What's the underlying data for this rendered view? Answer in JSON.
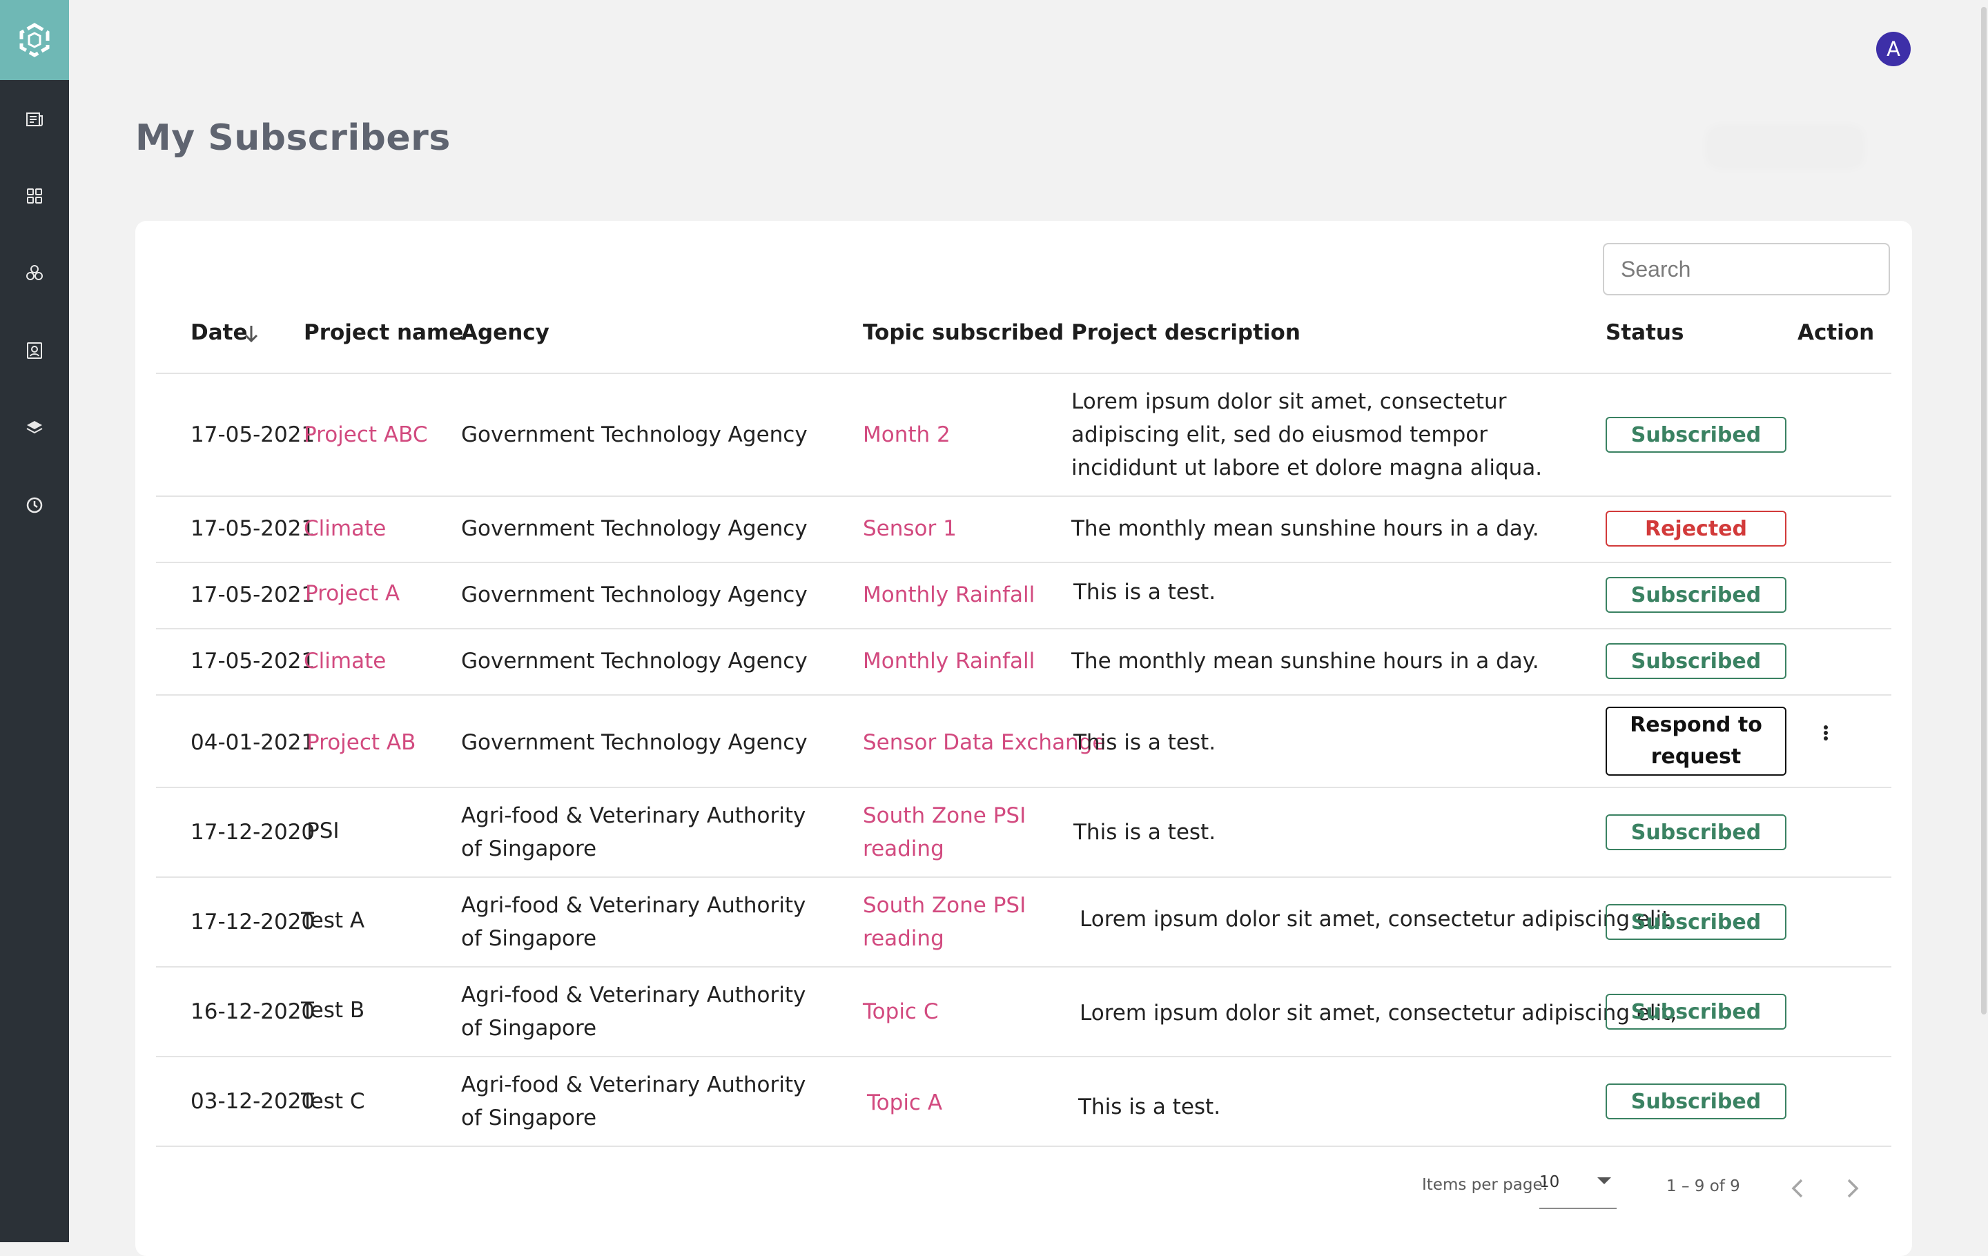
{
  "app": {
    "avatar_initial": "A",
    "accent_color": "#6fb8b5",
    "sidebar_color": "#2b3137"
  },
  "sidebar": {
    "items": [
      {
        "icon": "newspaper-icon"
      },
      {
        "icon": "grid-icon"
      },
      {
        "icon": "circles-cluster-icon"
      },
      {
        "icon": "contact-card-icon"
      },
      {
        "icon": "layers-icon"
      },
      {
        "icon": "clock-icon"
      }
    ]
  },
  "page": {
    "title": "My Subscribers"
  },
  "search": {
    "placeholder": "Search",
    "value": ""
  },
  "table": {
    "headers": {
      "date": "Date",
      "project_name": "Project name",
      "agency": "Agency",
      "topic": "Topic subscribed",
      "description": "Project description",
      "status": "Status",
      "action": "Action"
    },
    "sort": {
      "column": "date",
      "direction": "descending"
    },
    "rows": [
      {
        "date": "17-05-2021",
        "project": "Project ABC",
        "project_link": true,
        "agency": "Government Technology Agency",
        "topic": "Month 2",
        "description": "Lorem ipsum dolor sit amet, consectetur adipiscing elit, sed do eiusmod tempor incididunt ut labore et dolore magna aliqua.",
        "status": "Subscribed",
        "status_type": "subscribed"
      },
      {
        "date": "17-05-2021",
        "project": "Climate",
        "project_link": true,
        "agency": "Government Technology Agency",
        "topic": "Sensor 1",
        "description": "The monthly mean sunshine hours in a day.",
        "status": "Rejected",
        "status_type": "rejected"
      },
      {
        "date": "17-05-2021",
        "project": "Project A",
        "project_link": true,
        "agency": "Government Technology Agency",
        "topic": "Monthly Rainfall",
        "description": "This is a test.",
        "status": "Subscribed",
        "status_type": "subscribed"
      },
      {
        "date": "17-05-2021",
        "project": "Climate",
        "project_link": true,
        "agency": "Government Technology Agency",
        "topic": "Monthly Rainfall",
        "description": "The monthly mean sunshine hours in a day.",
        "status": "Subscribed",
        "status_type": "subscribed"
      },
      {
        "date": "04-01-2021",
        "project": "Project AB",
        "project_link": true,
        "agency": "Government Technology Agency",
        "topic": "Sensor Data Exchange",
        "description": "This is a test.",
        "status": "Respond to request",
        "status_type": "respond"
      },
      {
        "date": "17-12-2020",
        "project": "PSI",
        "project_link": false,
        "agency": "Agri-food & Veterinary Authority of Singapore",
        "topic": "South Zone PSI reading",
        "description": "This is a test.",
        "status": "Subscribed",
        "status_type": "subscribed"
      },
      {
        "date": "17-12-2020",
        "project": "Test A",
        "project_link": false,
        "agency": "Agri-food & Veterinary Authority of Singapore",
        "topic": "South Zone PSI reading",
        "description": "Lorem ipsum dolor sit amet, consectetur adipiscing elit",
        "status": "Subscribed",
        "status_type": "subscribed"
      },
      {
        "date": "16-12-2020",
        "project": "Test B",
        "project_link": false,
        "agency": "Agri-food & Veterinary Authority of Singapore",
        "topic": "Topic C",
        "description": "Lorem ipsum dolor sit amet, consectetur adipiscing elit,",
        "status": "Subscribed",
        "status_type": "subscribed"
      },
      {
        "date": "03-12-2020",
        "project": "Test C",
        "project_link": false,
        "agency": "Agri-food & Veterinary Authority of Singapore",
        "topic": "Topic A",
        "description": "This is a test.",
        "status": "Subscribed",
        "status_type": "subscribed"
      }
    ]
  },
  "pagination": {
    "items_per_page_label": "Items per page:",
    "items_per_page": "10",
    "range_label": "1 – 9 of 9"
  }
}
